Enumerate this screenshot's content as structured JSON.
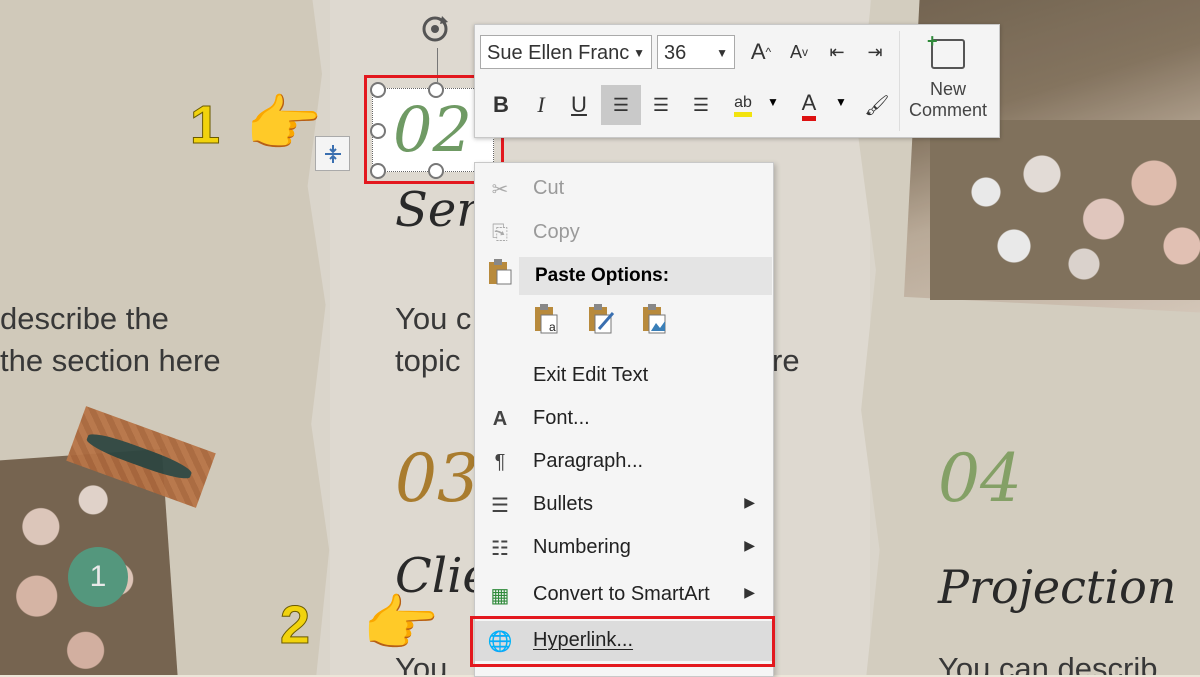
{
  "slide": {
    "left_text_line1": "describe the",
    "left_text_line2": "the section here",
    "mid_text_line1": "You c",
    "mid_text_line2": "topic",
    "mid_text_tail": "re",
    "number_02": "02",
    "number_03": "03",
    "number_04": "04",
    "heading_services": "Servi",
    "heading_clients": "Clien",
    "heading_projection": "Projection",
    "bottom_text_left": "You",
    "bottom_text_right": "You can describ",
    "step_badge": "1",
    "colors": {
      "number_02": "#6f9a64",
      "number_03": "#b8862f",
      "number_04": "#8fae6e",
      "badge": "#5aa487",
      "step_label": "#f1d30d",
      "highlight_border": "#e3181e"
    }
  },
  "steps": {
    "step1": "1",
    "step2": "2"
  },
  "mini_toolbar": {
    "font_name": "Sue Ellen Franc",
    "font_size": "36",
    "grow_font_icon": "A",
    "shrink_font_icon": "A",
    "bold": "B",
    "italic": "I",
    "underline": "U",
    "new_comment_line1": "New",
    "new_comment_line2": "Comment"
  },
  "context_menu": {
    "cut": "Cut",
    "copy": "Copy",
    "paste_options": "Paste Options:",
    "exit_edit_text": "Exit Edit Text",
    "font": "Font...",
    "paragraph": "Paragraph...",
    "bullets": "Bullets",
    "numbering": "Numbering",
    "convert_smartart": "Convert to SmartArt",
    "hyperlink": "Hyperlink..."
  }
}
